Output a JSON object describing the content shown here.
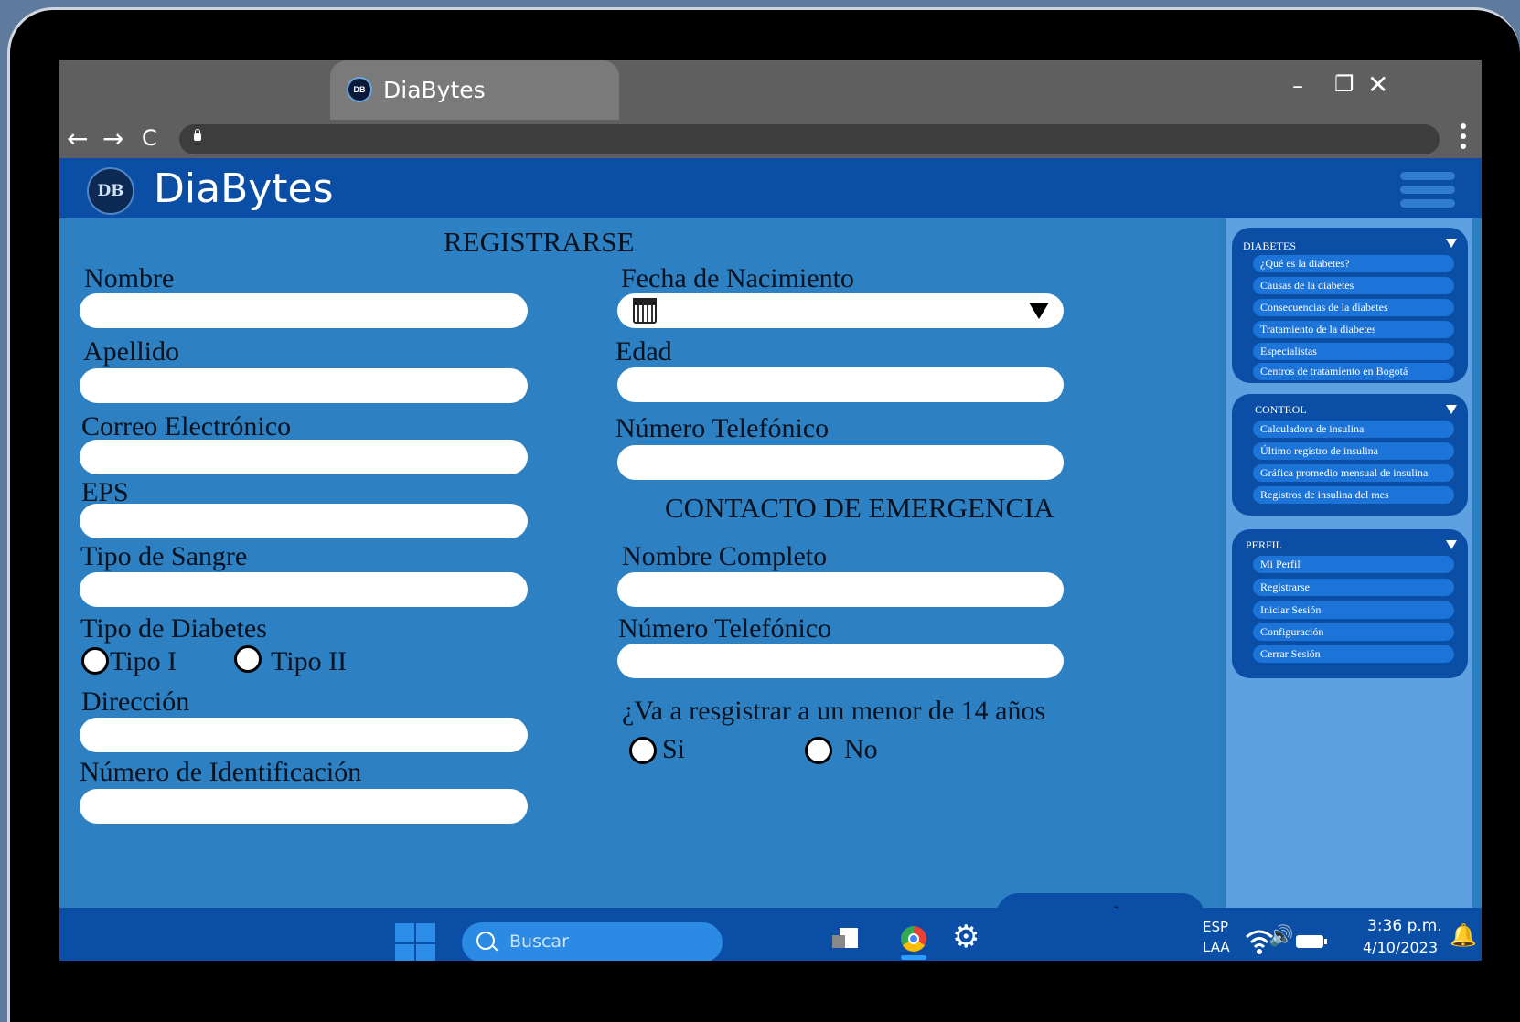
{
  "browser": {
    "tab_title": "DiaBytes",
    "tab_logo": "DB",
    "minimize": "–",
    "restore": "❐",
    "close": "✕",
    "back": "←",
    "forward": "→",
    "reload": "C"
  },
  "app": {
    "title": "DiaBytes",
    "logo": "DB"
  },
  "form": {
    "heading": "REGISTRARSE",
    "nombre": "Nombre",
    "apellido": "Apellido",
    "correo": "Correo Electrónico",
    "eps": "EPS",
    "tipo_sangre": "Tipo de Sangre",
    "tipo_diabetes": "Tipo de Diabetes",
    "tipo_1": "Tipo I",
    "tipo_2": "Tipo II",
    "direccion": "Dirección",
    "identificacion": "Número de Identificación",
    "fecha_nacimiento": "Fecha de Nacimiento",
    "edad": "Edad",
    "telefono": "Número Telefónico",
    "emergencia_heading": "CONTACTO DE EMERGENCIA",
    "nombre_completo": "Nombre Completo",
    "telefono_emergencia": "Número Telefónico",
    "menor_pregunta": "¿Va a resgistrar a un menor de 14 años",
    "si": "Si",
    "no": "No",
    "guardar": "Guardar"
  },
  "sidebar": {
    "groups": [
      {
        "title": "DIABETES",
        "items": [
          "¿Qué es la diabetes?",
          "Causas de la diabetes",
          "Consecuencias de la diabetes",
          "Tratamiento de la diabetes",
          "Especialistas",
          "Centros de tratamiento en Bogotá"
        ]
      },
      {
        "title": "CONTROL",
        "items": [
          "Calculadora de insulina",
          "Último registro de insulina",
          "Gráfica promedio mensual de insulina",
          "Registros de insulina del mes"
        ]
      },
      {
        "title": "PERFIL",
        "items": [
          "Mi Perfil",
          "Registrarse",
          "Iniciar Sesión",
          "Configuración",
          "Cerrar Sesión"
        ]
      }
    ]
  },
  "taskbar": {
    "search_placeholder": "Buscar",
    "lang_1": "ESP",
    "lang_2": "LAA",
    "time": "3:36 p.m.",
    "date": "4/10/2023",
    "wifi": "wifi-icon",
    "volume": "🔊",
    "bell": "🔔",
    "gear": "⚙"
  },
  "colors": {
    "primary": "#0a4ea6",
    "form_bg": "#2d80c2",
    "sidebar_bg": "#5ea1e0",
    "sidebar_item": "#1d74d8"
  }
}
